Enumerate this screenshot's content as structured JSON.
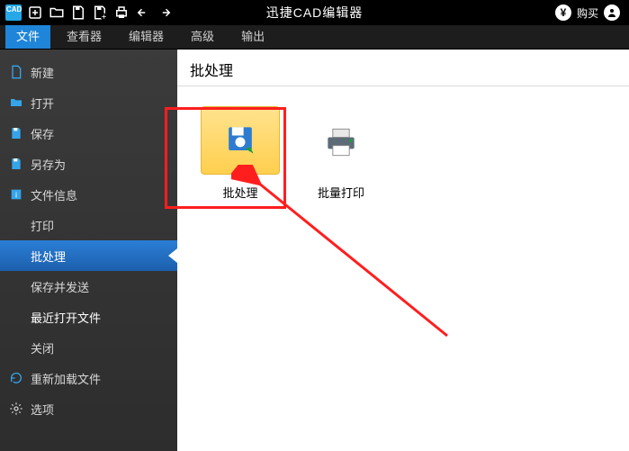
{
  "titlebar": {
    "app_abbrev": "CAD",
    "title": "迅捷CAD编辑器",
    "buy": "购买"
  },
  "ribbon": {
    "tabs": [
      "文件",
      "查看器",
      "编辑器",
      "高级",
      "输出"
    ],
    "active_index": 0
  },
  "sidemenu": {
    "items": [
      {
        "label": "新建",
        "icon": "file"
      },
      {
        "label": "打开",
        "icon": "folder-open"
      },
      {
        "label": "保存",
        "icon": "save"
      },
      {
        "label": "另存为",
        "icon": "save-as"
      },
      {
        "label": "文件信息",
        "icon": "info"
      },
      {
        "label": "打印",
        "icon": null
      },
      {
        "label": "批处理",
        "icon": null,
        "selected": true
      },
      {
        "label": "保存并发送",
        "icon": null
      },
      {
        "label": "最近打开文件",
        "icon": null,
        "bright": true
      },
      {
        "label": "关闭",
        "icon": null
      },
      {
        "label": "重新加载文件",
        "icon": "reload"
      },
      {
        "label": "选项",
        "icon": "gear"
      }
    ]
  },
  "content": {
    "heading": "批处理",
    "tiles": [
      {
        "label": "批处理",
        "icon": "batch-save",
        "highlight": true
      },
      {
        "label": "批量打印",
        "icon": "batch-print"
      }
    ]
  }
}
